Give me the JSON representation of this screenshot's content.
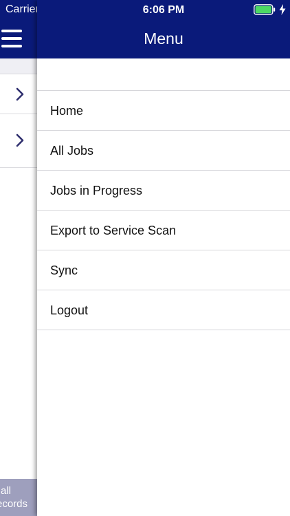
{
  "status_bar": {
    "carrier": "Carrier",
    "time": "6:06 PM"
  },
  "menu": {
    "title": "Menu",
    "items": [
      {
        "label": "Home"
      },
      {
        "label": "All Jobs"
      },
      {
        "label": "Jobs in Progress"
      },
      {
        "label": "Export to Service Scan"
      },
      {
        "label": "Sync"
      },
      {
        "label": "Logout"
      }
    ]
  },
  "background_screen": {
    "bottom_button_line1": "all",
    "bottom_button_line2": "ecords"
  },
  "colors": {
    "nav_bar": "#0a1a7a",
    "bottom_button": "#9e9fbd",
    "battery": "#4cd964"
  }
}
